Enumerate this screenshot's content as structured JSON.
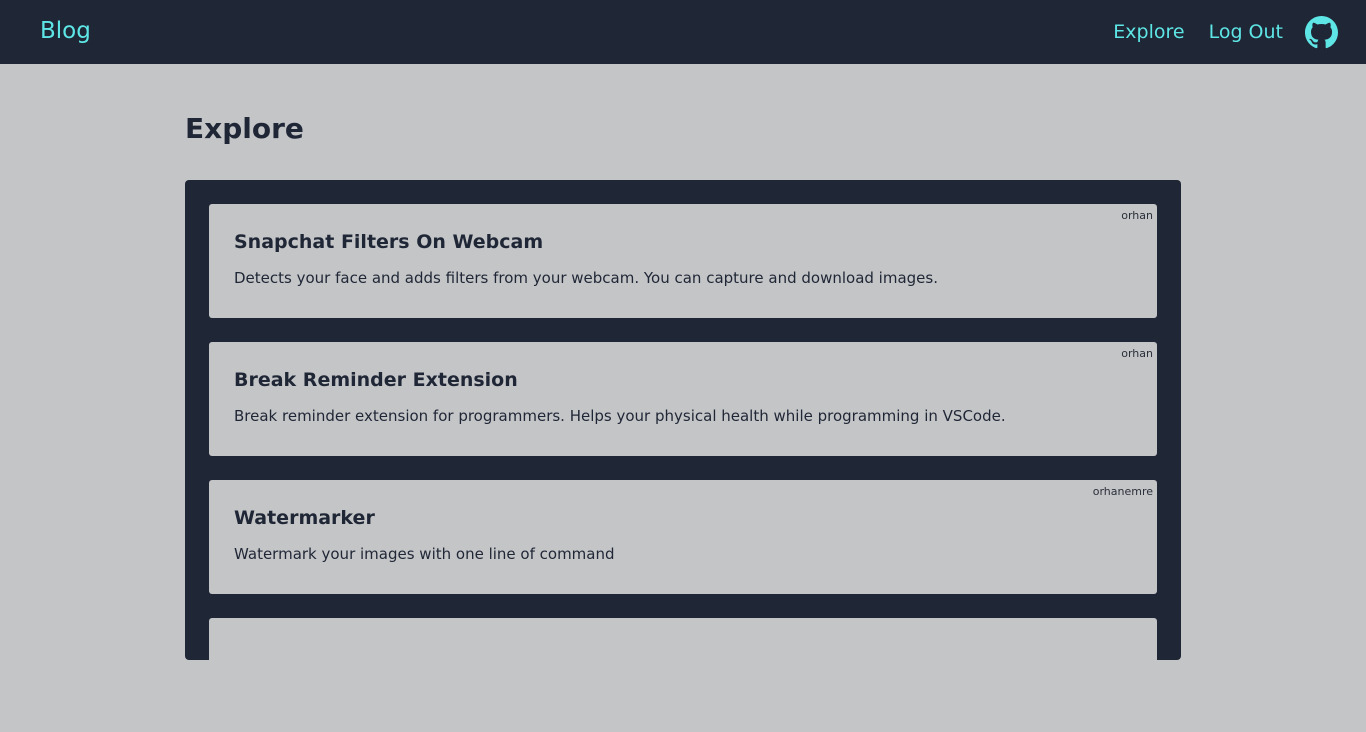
{
  "navbar": {
    "brand": "Blog",
    "links": [
      {
        "label": "Explore"
      },
      {
        "label": "Log Out"
      }
    ],
    "github_icon": "github-icon"
  },
  "page": {
    "title": "Explore"
  },
  "posts": [
    {
      "title": "Snapchat Filters On Webcam",
      "description": "Detects your face and adds filters from your webcam. You can capture and download images.",
      "author": "orhan"
    },
    {
      "title": "Break Reminder Extension",
      "description": "Break reminder extension for programmers. Helps your physical health while programming in VSCode.",
      "author": "orhan"
    },
    {
      "title": "Watermarker",
      "description": "Watermark your images with one line of command",
      "author": "orhanemre"
    }
  ],
  "colors": {
    "navbar_bg": "#1f2635",
    "accent": "#5ee6e6",
    "page_bg": "#c4c5c7",
    "text_dark": "#1f2635"
  }
}
